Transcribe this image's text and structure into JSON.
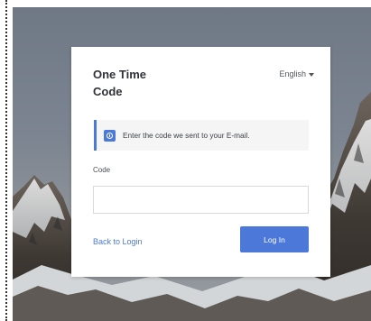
{
  "modal": {
    "title_line_1": "One Time",
    "title_line_2": "Code",
    "language": "English",
    "language_icon": "chevron-down-icon"
  },
  "alert": {
    "icon": "info-icon",
    "message": "Enter the code we sent to your E-mail.",
    "accent_color": "#4c79d9"
  },
  "form": {
    "code_label": "Code",
    "code_value": "",
    "back_link": "Back to Login",
    "login_button": "Log In",
    "button_color": "#4c79d9"
  },
  "background": {
    "theme": "snowy-mountains",
    "sky_color": "#747d88"
  }
}
